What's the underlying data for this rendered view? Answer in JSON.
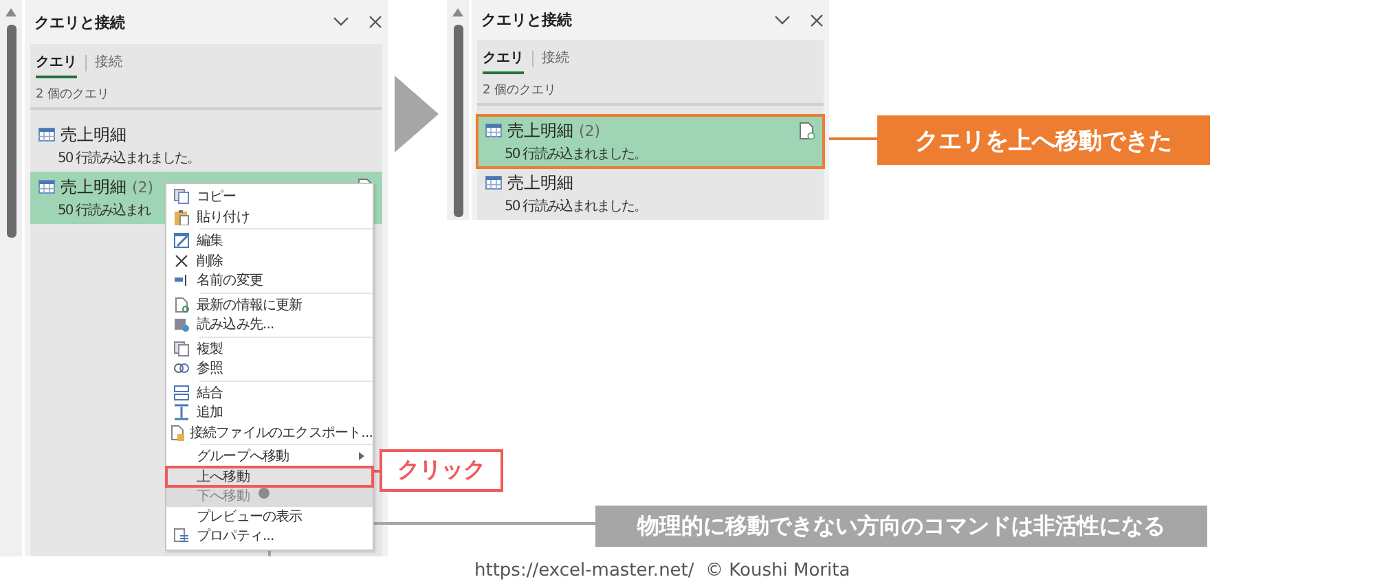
{
  "panels": [
    {
      "title": "クエリと接続",
      "tabs": [
        {
          "label": "クエリ",
          "selected": true
        },
        {
          "label": "接続",
          "selected": false
        }
      ],
      "count": "2 個のクエリ",
      "queries": [
        {
          "name": "売上明細",
          "status": "50 行読み込まれました。",
          "selected": false,
          "outlined": false
        },
        {
          "name": "売上明細",
          "suffix": "(2)",
          "status": "50 行読み込まれ",
          "selected": true,
          "outlined": false
        }
      ]
    },
    {
      "title": "クエリと接続",
      "tabs": [
        {
          "label": "クエリ",
          "selected": true
        },
        {
          "label": "接続",
          "selected": false
        }
      ],
      "count": "2 個のクエリ",
      "queries": [
        {
          "name": "売上明細",
          "suffix": "(2)",
          "status": "50 行読み込まれました。",
          "selected": true,
          "outlined": true
        },
        {
          "name": "売上明細",
          "status": "50 行読み込まれました。",
          "selected": false,
          "outlined": false
        }
      ]
    }
  ],
  "context_menu": {
    "groups": [
      [
        {
          "label": "コピー",
          "disabled": false,
          "highlighted": false,
          "submenu": false,
          "marked": false
        },
        {
          "label": "貼り付け",
          "disabled": false,
          "highlighted": false,
          "submenu": false,
          "marked": false
        }
      ],
      [
        {
          "label": "編集",
          "disabled": false,
          "highlighted": false,
          "submenu": false,
          "marked": false
        },
        {
          "label": "削除",
          "disabled": false,
          "highlighted": false,
          "submenu": false,
          "marked": false
        },
        {
          "label": "名前の変更",
          "disabled": false,
          "highlighted": false,
          "submenu": false,
          "marked": false
        }
      ],
      [
        {
          "label": "最新の情報に更新",
          "disabled": false,
          "highlighted": false,
          "submenu": false,
          "marked": false
        },
        {
          "label": "読み込み先...",
          "disabled": false,
          "highlighted": false,
          "submenu": false,
          "marked": false
        }
      ],
      [
        {
          "label": "複製",
          "disabled": false,
          "highlighted": false,
          "submenu": false,
          "marked": false
        },
        {
          "label": "参照",
          "disabled": false,
          "highlighted": false,
          "submenu": false,
          "marked": false
        }
      ],
      [
        {
          "label": "結合",
          "disabled": false,
          "highlighted": false,
          "submenu": false,
          "marked": false
        },
        {
          "label": "追加",
          "disabled": false,
          "highlighted": false,
          "submenu": false,
          "marked": false
        },
        {
          "label": "接続ファイルのエクスポート...",
          "disabled": false,
          "highlighted": false,
          "submenu": false,
          "marked": false
        }
      ],
      [
        {
          "label": "グループへ移動",
          "disabled": false,
          "highlighted": false,
          "submenu": true,
          "marked": false
        },
        {
          "label": "上へ移動",
          "disabled": false,
          "highlighted": true,
          "submenu": false,
          "marked": true
        },
        {
          "label": "下へ移動",
          "disabled": true,
          "highlighted": true,
          "submenu": false,
          "marked": false
        },
        {
          "label": "プレビューの表示",
          "disabled": false,
          "highlighted": false,
          "submenu": false,
          "marked": false
        },
        {
          "label": "プロパティ...",
          "disabled": false,
          "highlighted": false,
          "submenu": false,
          "marked": false
        }
      ]
    ]
  },
  "callouts": [
    {
      "kind": "click",
      "text": "クリック"
    },
    {
      "kind": "result",
      "text": "クエリを上へ移動できた"
    },
    {
      "kind": "note",
      "text": "物理的に移動できない方向のコマンドは非活性になる"
    }
  ],
  "credit": "https://excel-master.net/  © Koushi Morita"
}
